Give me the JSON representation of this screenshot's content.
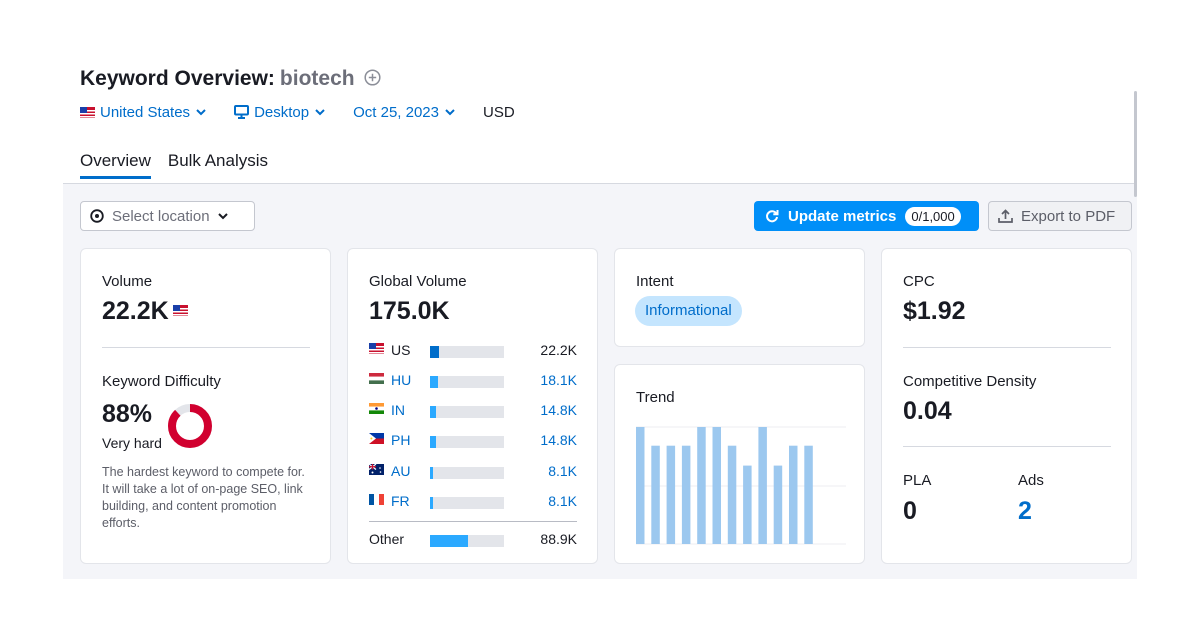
{
  "header": {
    "title": "Keyword Overview:",
    "keyword": "biotech"
  },
  "filters": {
    "country": "United States",
    "device": "Desktop",
    "date": "Oct 25, 2023",
    "currency": "USD"
  },
  "tabs": [
    {
      "label": "Overview",
      "active": true
    },
    {
      "label": "Bulk Analysis",
      "active": false
    }
  ],
  "toolbar": {
    "location_placeholder": "Select location",
    "update_label": "Update metrics",
    "update_badge": "0/1,000",
    "export_label": "Export to PDF"
  },
  "volume": {
    "label": "Volume",
    "value": "22.2K"
  },
  "keyword_difficulty": {
    "label": "Keyword Difficulty",
    "value": "88%",
    "percent": 88,
    "level": "Very hard",
    "description": "The hardest keyword to compete for. It will take a lot of on-page SEO, link building, and content promotion efforts.",
    "color": "#d1002f"
  },
  "global_volume": {
    "label": "Global Volume",
    "value": "175.0K",
    "rows": [
      {
        "code": "US",
        "value": "22.2K",
        "share": 0.127,
        "link": false
      },
      {
        "code": "HU",
        "value": "18.1K",
        "share": 0.103,
        "link": true
      },
      {
        "code": "IN",
        "value": "14.8K",
        "share": 0.085,
        "link": true
      },
      {
        "code": "PH",
        "value": "14.8K",
        "share": 0.085,
        "link": true
      },
      {
        "code": "AU",
        "value": "8.1K",
        "share": 0.046,
        "link": true
      },
      {
        "code": "FR",
        "value": "8.1K",
        "share": 0.046,
        "link": true
      }
    ],
    "other": {
      "label": "Other",
      "value": "88.9K",
      "share": 0.508
    }
  },
  "intent": {
    "label": "Intent",
    "value": "Informational"
  },
  "trend": {
    "label": "Trend",
    "values": [
      1.0,
      0.84,
      0.84,
      0.84,
      1.0,
      1.0,
      0.84,
      0.67,
      1.0,
      0.67,
      0.84,
      0.84
    ],
    "color": "#9cc8ef"
  },
  "cpc": {
    "label": "CPC",
    "value": "$1.92"
  },
  "competitive_density": {
    "label": "Competitive Density",
    "value": "0.04"
  },
  "pla": {
    "label": "PLA",
    "value": "0"
  },
  "ads": {
    "label": "Ads",
    "value": "2"
  },
  "colors": {
    "accent": "#008ff8",
    "link": "#006dca",
    "bar_top": "#006dca",
    "bar_other": "#2ba9ff"
  }
}
